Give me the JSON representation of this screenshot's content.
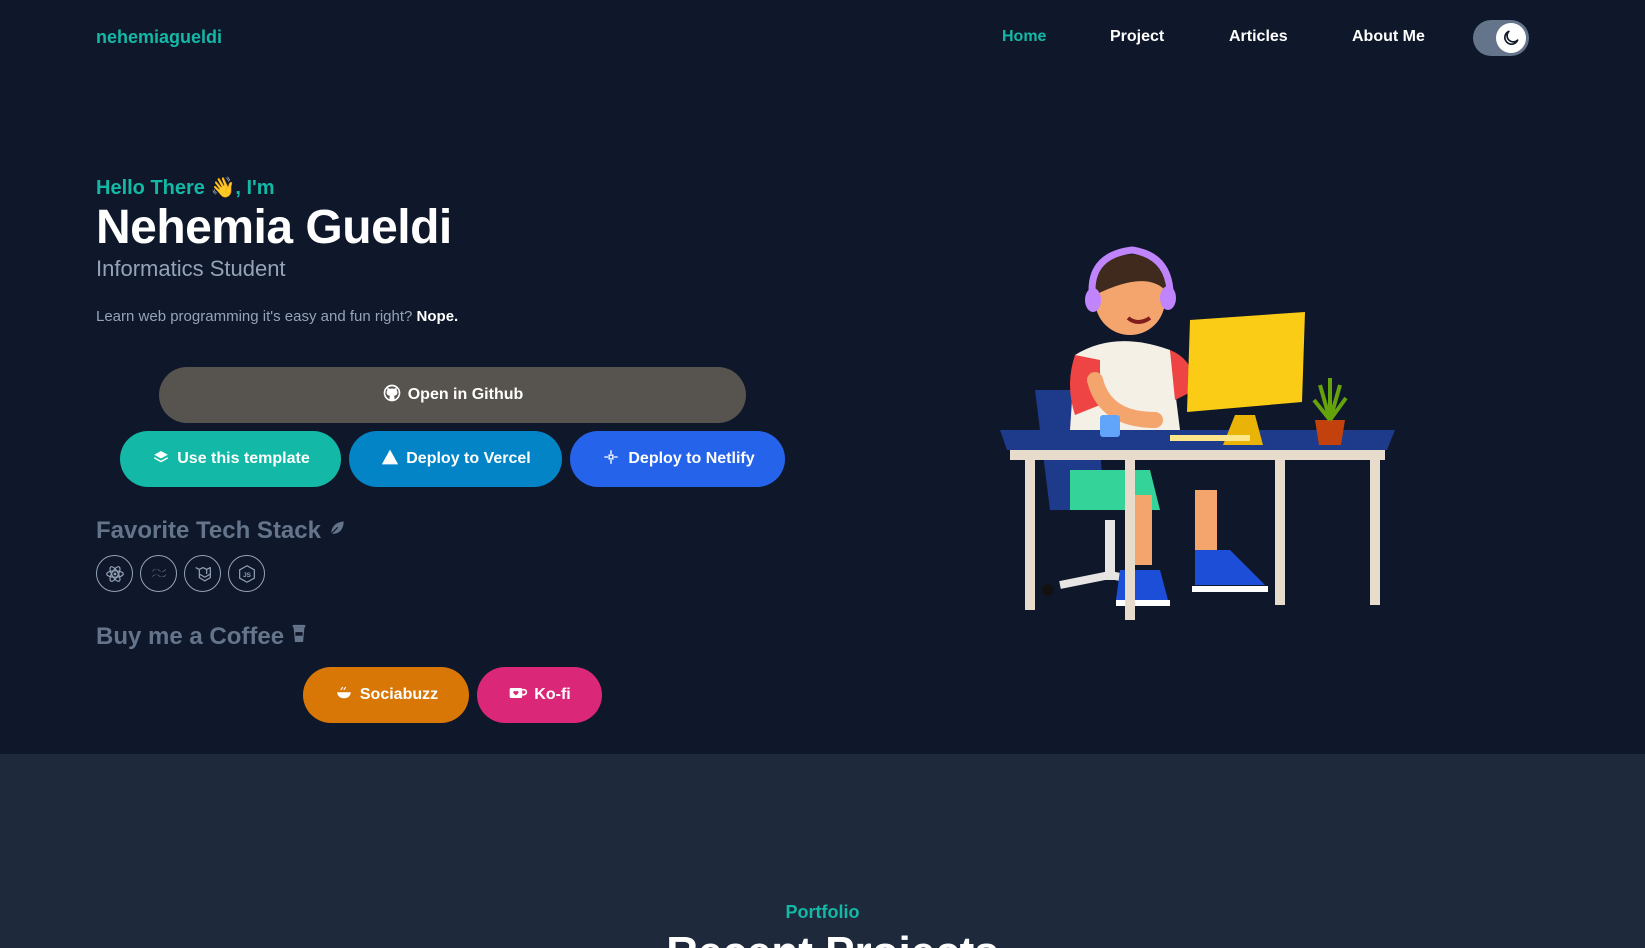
{
  "nav": {
    "brand": "nehemiagueldi",
    "links": [
      {
        "label": "Home",
        "active": true
      },
      {
        "label": "Project"
      },
      {
        "label": "Articles"
      },
      {
        "label": "About Me"
      }
    ],
    "theme_toggle_icon": "moon-icon"
  },
  "hero": {
    "greeting": "Hello There 👋, I'm",
    "name": "Nehemia Gueldi",
    "role": "Informatics Student",
    "tagline": "Learn web programming it's easy and fun right?",
    "tagline_emphasis": "Nope.",
    "buttons": {
      "github": "Open in Github",
      "template": "Use this template",
      "vercel": "Deploy to Vercel",
      "netlify": "Deploy to Netlify"
    }
  },
  "tech_stack": {
    "title": "Favorite Tech Stack",
    "icons": [
      "react-icon",
      "tailwind-icon",
      "laravel-icon",
      "nodejs-icon"
    ]
  },
  "coffee": {
    "title": "Buy me a Coffee",
    "sociabuzz": "Sociabuzz",
    "kofi": "Ko-fi"
  },
  "portfolio": {
    "eyebrow": "Portfolio",
    "title": "Recent Projects"
  },
  "colors": {
    "background": "#0f172a",
    "accent": "#14b8a6",
    "band": "#1e293b"
  }
}
